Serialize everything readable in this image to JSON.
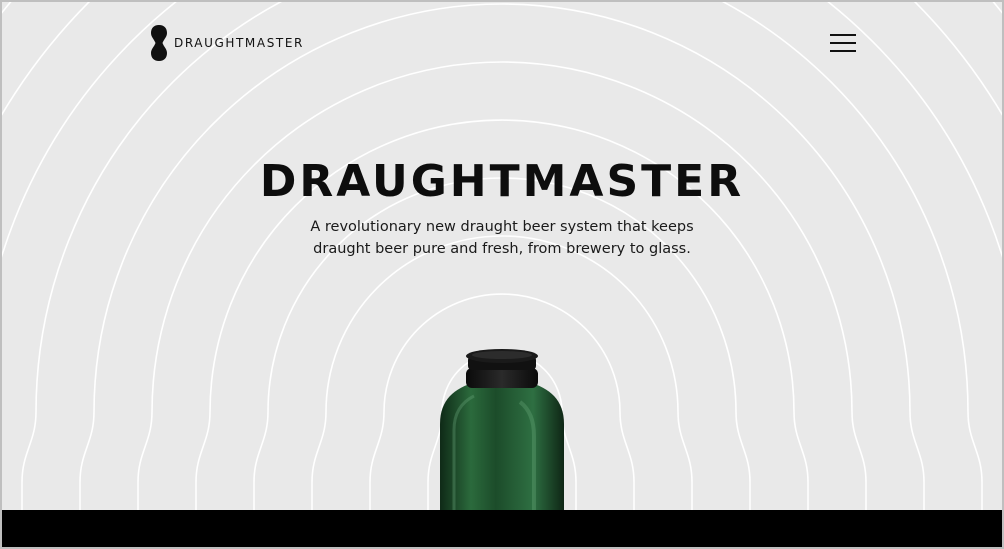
{
  "brand": {
    "name": "DRAUGHTMASTER"
  },
  "header": {
    "menu_icon": "hamburger-menu-icon"
  },
  "hero": {
    "title": "DRAUGHTMASTER",
    "subtitle_line1": "A revolutionary new draught beer system that keeps",
    "subtitle_line2": "draught beer pure and fresh, from brewery to glass."
  },
  "product": {
    "icon": "green-keg-image",
    "color": "#1f4a2b"
  },
  "colors": {
    "background": "#e9e9e9",
    "rings": "#ffffff",
    "text": "#0d0d0d",
    "footer": "#000000"
  }
}
